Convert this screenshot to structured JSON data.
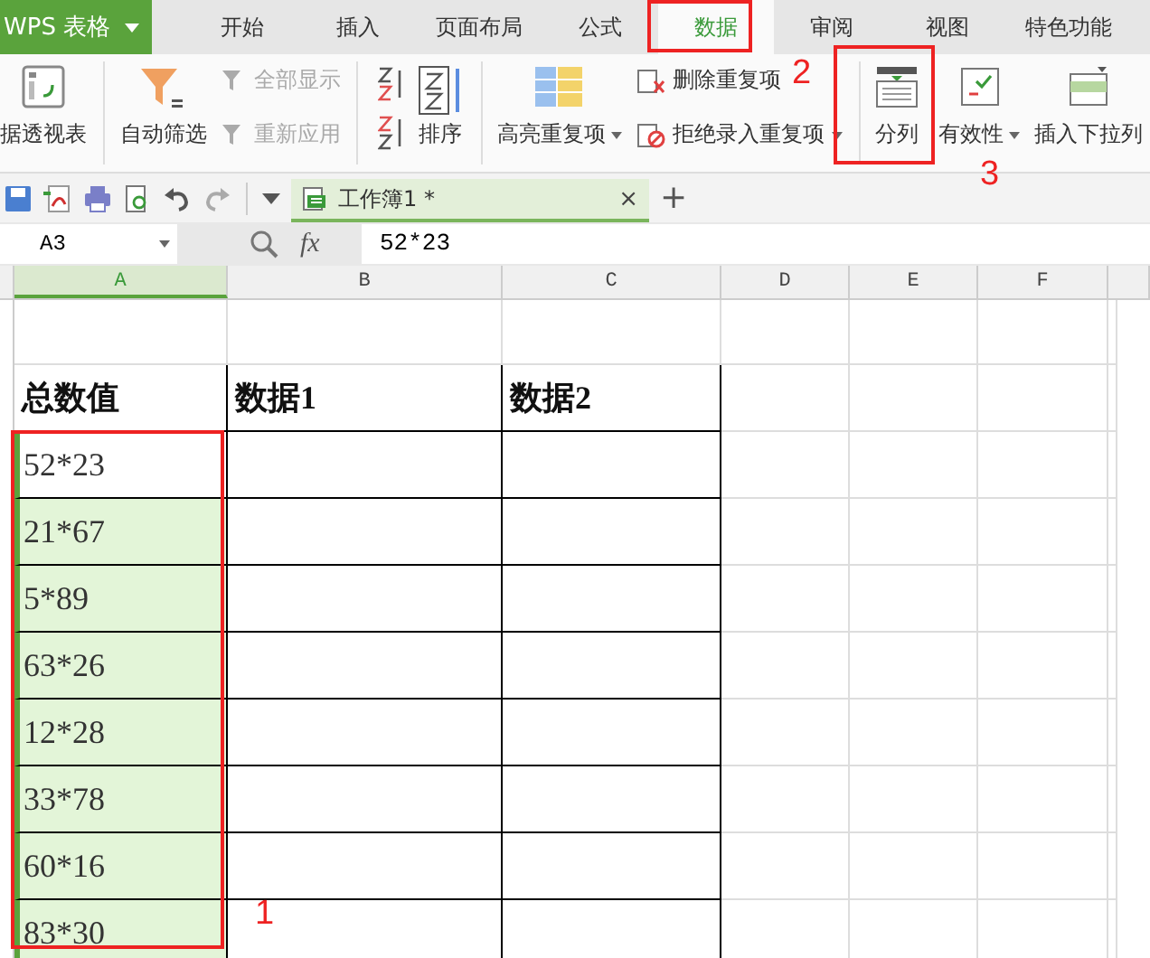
{
  "app": {
    "title": "WPS 表格"
  },
  "tabs": [
    {
      "label": "开始",
      "selected": false
    },
    {
      "label": "插入",
      "selected": false
    },
    {
      "label": "页面布局",
      "selected": false
    },
    {
      "label": "公式",
      "selected": false
    },
    {
      "label": "数据",
      "selected": true
    },
    {
      "label": "审阅",
      "selected": false
    },
    {
      "label": "视图",
      "selected": false
    },
    {
      "label": "特色功能",
      "selected": false
    }
  ],
  "ribbon": [
    {
      "label": "据透视表",
      "disabled": false
    },
    {
      "label": "自动筛选",
      "disabled": false
    },
    {
      "label": "全部显示",
      "disabled": true
    },
    {
      "label": "重新应用",
      "disabled": true
    },
    {
      "label": "排序",
      "disabled": false
    },
    {
      "label": "高亮重复项",
      "disabled": false
    },
    {
      "label": "删除重复项",
      "disabled": false
    },
    {
      "label": "拒绝录入重复项",
      "disabled": false
    },
    {
      "label": "分列",
      "disabled": false
    },
    {
      "label": "有效性",
      "disabled": false
    },
    {
      "label": "插入下拉列",
      "disabled": false
    }
  ],
  "document_tab": {
    "title": "工作簿1 *",
    "close": "×",
    "new_tab": "+"
  },
  "formula_bar": {
    "name_box": "A3",
    "fx": "fx",
    "formula": "52*23"
  },
  "columns": [
    {
      "label": "A",
      "selected": true
    },
    {
      "label": "B",
      "selected": false
    },
    {
      "label": "C",
      "selected": false
    },
    {
      "label": "D",
      "selected": false
    },
    {
      "label": "E",
      "selected": false
    },
    {
      "label": "F",
      "selected": false
    }
  ],
  "table": {
    "header": [
      "总数值",
      "数据1",
      "数据2"
    ],
    "rows": [
      {
        "value": "52*23",
        "highlighted": false
      },
      {
        "value": "21*67",
        "highlighted": true
      },
      {
        "value": "5*89",
        "highlighted": true
      },
      {
        "value": "63*26",
        "highlighted": true
      },
      {
        "value": "12*28",
        "highlighted": true
      },
      {
        "value": "33*78",
        "highlighted": true
      },
      {
        "value": "60*16",
        "highlighted": true
      },
      {
        "value": "83*30",
        "highlighted": true
      }
    ]
  },
  "annotations": [
    {
      "label": "2"
    },
    {
      "label": "3"
    },
    {
      "label": "1"
    }
  ]
}
